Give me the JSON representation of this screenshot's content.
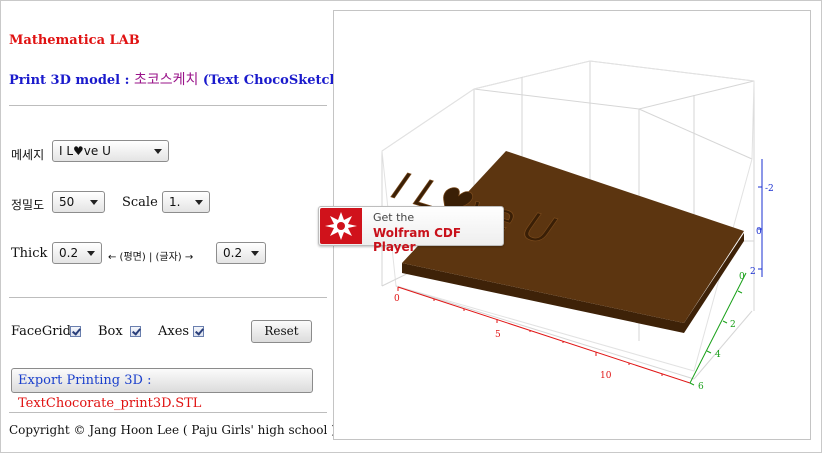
{
  "app": {
    "title": "Mathematica LAB",
    "model_prefix": "Print 3D model : ",
    "model_korean": "초코스케치",
    "model_english": " (Text ChocoSketch)"
  },
  "controls": {
    "message_label": "메세지",
    "message_value": "I L♥ve U",
    "density_label": "정밀도",
    "density_value": "50",
    "scale_label": "Scale",
    "scale_value": "1.",
    "thick_label": "Thick",
    "thick_plane_value": "0.2",
    "thick_mid_text": "← (평면) | (글자) →",
    "thick_letter_value": "0.2"
  },
  "options": {
    "facegrid_label": "FaceGrid",
    "facegrid_checked": true,
    "box_label": "Box",
    "box_checked": true,
    "axes_label": "Axes",
    "axes_checked": true,
    "reset_label": "Reset"
  },
  "export": {
    "label": "Export Printing 3D  : ",
    "filename": "TextChocorate_print3D.STL"
  },
  "footer": {
    "copyright": "Copyright © Jang Hoon Lee ( Paju Girls' high school )"
  },
  "viewer": {
    "model_text": "I L♥ve U",
    "x_ticks": [
      "0",
      "5",
      "10"
    ],
    "y_ticks": [
      "0",
      "2",
      "4",
      "6"
    ],
    "z_ticks": [
      "-2",
      "0",
      "2"
    ],
    "colors": {
      "chocolate_top": "#5c3510",
      "chocolate_side": "#3e2208",
      "x_axis": "#e01515",
      "y_axis": "#18a018",
      "z_axis": "#1a2fd0"
    }
  },
  "cdf_badge": {
    "line1": "Get the",
    "line2": "Wolfram CDF Player"
  }
}
